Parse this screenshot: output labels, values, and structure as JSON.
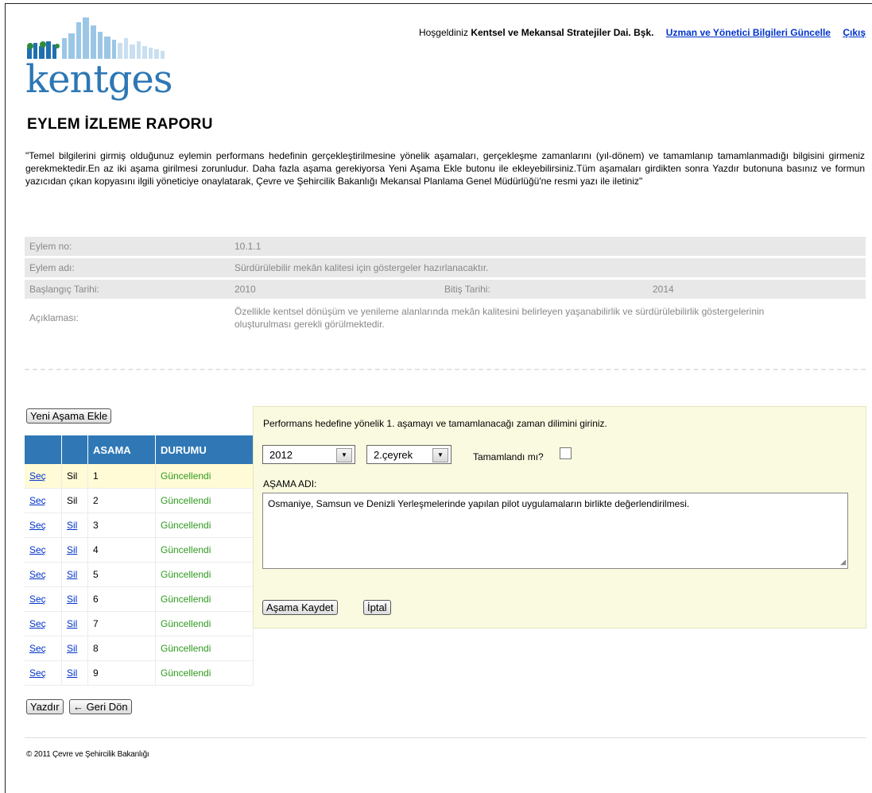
{
  "brand": {
    "logo_text": "kentges"
  },
  "header": {
    "welcome": "Hoşgeldiniz",
    "user": "Kentsel ve Mekansal Stratejiler Dai. Bşk.",
    "update_link": "Uzman ve Yönetici Bilgileri Güncelle",
    "logout_link": "Çıkış"
  },
  "page": {
    "title": "EYLEM İZLEME RAPORU",
    "intro": "\"Temel bilgilerini girmiş olduğunuz eylemin performans hedefinin gerçekleştirilmesine yönelik aşamaları, gerçekleşme zamanlarını (yıl-dönem) ve tamamlanıp tamamlanmadığı bilgisini girmeniz gerekmektedir.En az iki aşama girilmesi zorunludur. Daha fazla aşama gerekiyorsa Yeni Aşama Ekle butonu ile ekleyebilirsiniz.Tüm aşamaları girdikten sonra Yazdır butonuna basınız ve formun yazıcıdan çıkan kopyasını ilgili yöneticiye onaylatarak, Çevre ve Şehircilik Bakanlığı Mekansal Planlama Genel Müdürlüğü'ne resmi yazı ile iletiniz\""
  },
  "info": {
    "no_label": "Eylem no:",
    "no_value": "10.1.1",
    "name_label": "Eylem adı:",
    "name_value": "Sürdürülebilir mekân kalitesi için göstergeler hazırlanacaktır.",
    "start_label": "Başlangıç Tarihi:",
    "start_value": "2010",
    "end_label": "Bitiş Tarihi:",
    "end_value": "2014",
    "desc_label": "Açıklaması:",
    "desc_value": "Özellikle kentsel dönüşüm ve yenileme alanlarında mekân kalitesini belirleyen yaşanabilirlik ve sürdürülebilirlik göstergelerinin oluşturulması gerekli görülmektedir."
  },
  "stages": {
    "add_button": "Yeni Aşama Ekle",
    "col_stage": "ASAMA",
    "col_status": "DURUMU",
    "select_label": "Seç",
    "delete_label": "Sil",
    "rows": [
      {
        "n": "1",
        "status": "Güncellendi"
      },
      {
        "n": "2",
        "status": "Güncellendi"
      },
      {
        "n": "3",
        "status": "Güncellendi"
      },
      {
        "n": "4",
        "status": "Güncellendi"
      },
      {
        "n": "5",
        "status": "Güncellendi"
      },
      {
        "n": "6",
        "status": "Güncellendi"
      },
      {
        "n": "7",
        "status": "Güncellendi"
      },
      {
        "n": "8",
        "status": "Güncellendi"
      },
      {
        "n": "9",
        "status": "Güncellendi"
      }
    ]
  },
  "form": {
    "hint": "Performans hedefine yönelik 1. aşamayı ve tamamlanacağı zaman dilimini giriniz.",
    "year": "2012",
    "quarter": "2.çeyrek",
    "done_label": "Tamamlandı mı?",
    "stage_label": "AŞAMA ADI:",
    "stage_value": "Osmaniye, Samsun ve Denizli Yerleşmelerinde yapılan pilot uygulamaların birlikte değerlendirilmesi.",
    "save_button": "Aşama Kaydet",
    "cancel_button": "İptal"
  },
  "actions": {
    "print_button": "Yazdır",
    "back_button": "← Geri Dön"
  },
  "footer": {
    "copyright": "© 2011 Çevre ve Şehircilik Bakanlığı"
  }
}
